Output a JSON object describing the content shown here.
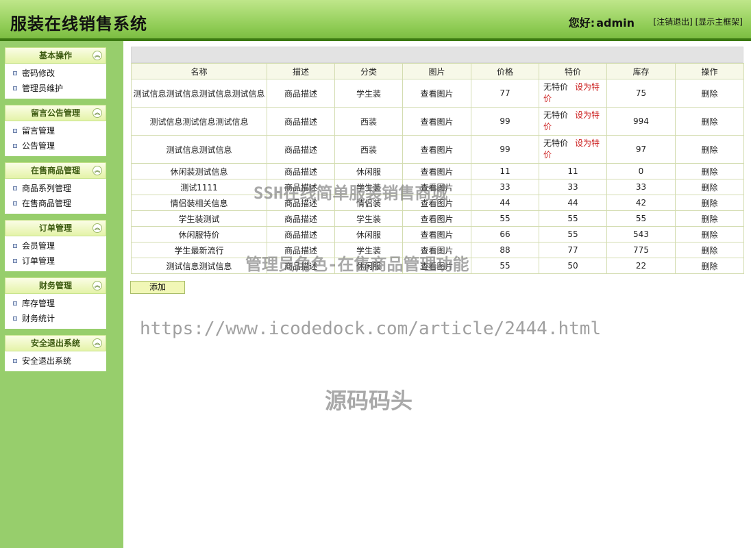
{
  "header": {
    "title": "服装在线销售系统",
    "greeting_label": "您好:",
    "username": "admin",
    "logout_link": "[注销退出]",
    "show_frame_link": "[显示主框架]"
  },
  "sidebar": {
    "panels": [
      {
        "title": "基本操作",
        "items": [
          "密码修改",
          "管理员维护"
        ]
      },
      {
        "title": "留言公告管理",
        "items": [
          "留言管理",
          "公告管理"
        ]
      },
      {
        "title": "在售商品管理",
        "items": [
          "商品系列管理",
          "在售商品管理"
        ]
      },
      {
        "title": "订单管理",
        "items": [
          "会员管理",
          "订单管理"
        ]
      },
      {
        "title": "财务管理",
        "items": [
          "库存管理",
          "财务统计"
        ]
      },
      {
        "title": "安全退出系统",
        "items": [
          "安全退出系统"
        ]
      }
    ],
    "toggle_glyph": "︽"
  },
  "table": {
    "headers": [
      "名称",
      "描述",
      "分类",
      "图片",
      "价格",
      "特价",
      "库存",
      "操作"
    ],
    "rows": [
      {
        "name": "测试信息测试信息测试信息测试信息",
        "desc": "商品描述",
        "category": "学生装",
        "image": "查看图片",
        "price": "77",
        "special": "无特价",
        "set_special": "设为特价",
        "stock": "75",
        "action": "删除"
      },
      {
        "name": "测试信息测试信息测试信息",
        "desc": "商品描述",
        "category": "西装",
        "image": "查看图片",
        "price": "99",
        "special": "无特价",
        "set_special": "设为特价",
        "stock": "994",
        "action": "删除"
      },
      {
        "name": "测试信息测试信息",
        "desc": "商品描述",
        "category": "西装",
        "image": "查看图片",
        "price": "99",
        "special": "无特价",
        "set_special": "设为特价",
        "stock": "97",
        "action": "删除"
      },
      {
        "name": "休闲装测试信息",
        "desc": "商品描述",
        "category": "休闲服",
        "image": "查看图片",
        "price": "11",
        "special": "11",
        "set_special": "",
        "stock": "0",
        "action": "删除"
      },
      {
        "name": "测试1111",
        "desc": "商品描述",
        "category": "学生装",
        "image": "查看图片",
        "price": "33",
        "special": "33",
        "set_special": "",
        "stock": "33",
        "action": "删除"
      },
      {
        "name": "情侣装相关信息",
        "desc": "商品描述",
        "category": "情侣装",
        "image": "查看图片",
        "price": "44",
        "special": "44",
        "set_special": "",
        "stock": "42",
        "action": "删除"
      },
      {
        "name": "学生装测试",
        "desc": "商品描述",
        "category": "学生装",
        "image": "查看图片",
        "price": "55",
        "special": "55",
        "set_special": "",
        "stock": "55",
        "action": "删除"
      },
      {
        "name": "休闲服特价",
        "desc": "商品描述",
        "category": "休闲服",
        "image": "查看图片",
        "price": "66",
        "special": "55",
        "set_special": "",
        "stock": "543",
        "action": "删除"
      },
      {
        "name": "学生最新流行",
        "desc": "商品描述",
        "category": "学生装",
        "image": "查看图片",
        "price": "88",
        "special": "77",
        "set_special": "",
        "stock": "775",
        "action": "删除"
      },
      {
        "name": "测试信息测试信息",
        "desc": "商品描述",
        "category": "休闲服",
        "image": "查看图片",
        "price": "55",
        "special": "50",
        "set_special": "",
        "stock": "22",
        "action": "删除"
      }
    ]
  },
  "add_button": "添加",
  "watermarks": {
    "line1": "SSH在线简单服装销售商城",
    "line2": "管理员角色-在售商品管理功能",
    "url": "https://www.icodedock.com/article/2444.html",
    "brand": "源码码头"
  },
  "colors": {
    "header_green": "#8fcc55",
    "sidebar_green": "#97ce6c",
    "link_red": "#cc2222"
  }
}
